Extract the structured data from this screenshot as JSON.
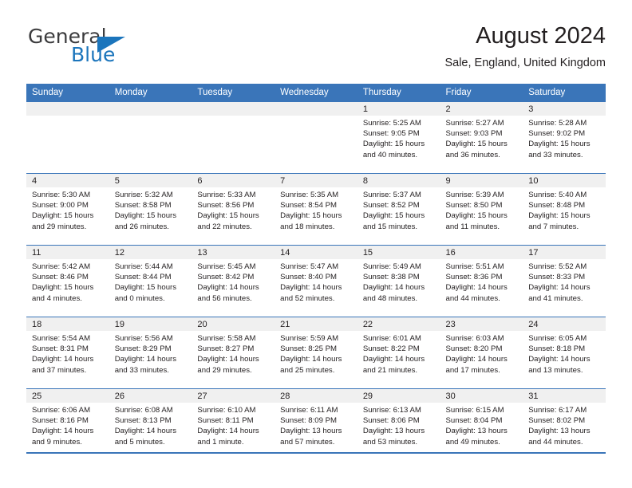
{
  "brand": {
    "name_part1": "General",
    "name_part2": "Blue",
    "triangle_icon": "triangle-icon",
    "accent_color": "#1b75bc"
  },
  "header": {
    "month_title": "August 2024",
    "location": "Sale, England, United Kingdom"
  },
  "theme": {
    "header_blue": "#3a75b9",
    "daynum_band": "#f0f0f0",
    "text": "#231f20"
  },
  "calendar": {
    "weekday_headers": [
      "Sunday",
      "Monday",
      "Tuesday",
      "Wednesday",
      "Thursday",
      "Friday",
      "Saturday"
    ],
    "weeks": [
      [
        {
          "day": "",
          "lines": []
        },
        {
          "day": "",
          "lines": []
        },
        {
          "day": "",
          "lines": []
        },
        {
          "day": "",
          "lines": []
        },
        {
          "day": "1",
          "lines": [
            "Sunrise: 5:25 AM",
            "Sunset: 9:05 PM",
            "Daylight: 15 hours",
            "and 40 minutes."
          ]
        },
        {
          "day": "2",
          "lines": [
            "Sunrise: 5:27 AM",
            "Sunset: 9:03 PM",
            "Daylight: 15 hours",
            "and 36 minutes."
          ]
        },
        {
          "day": "3",
          "lines": [
            "Sunrise: 5:28 AM",
            "Sunset: 9:02 PM",
            "Daylight: 15 hours",
            "and 33 minutes."
          ]
        }
      ],
      [
        {
          "day": "4",
          "lines": [
            "Sunrise: 5:30 AM",
            "Sunset: 9:00 PM",
            "Daylight: 15 hours",
            "and 29 minutes."
          ]
        },
        {
          "day": "5",
          "lines": [
            "Sunrise: 5:32 AM",
            "Sunset: 8:58 PM",
            "Daylight: 15 hours",
            "and 26 minutes."
          ]
        },
        {
          "day": "6",
          "lines": [
            "Sunrise: 5:33 AM",
            "Sunset: 8:56 PM",
            "Daylight: 15 hours",
            "and 22 minutes."
          ]
        },
        {
          "day": "7",
          "lines": [
            "Sunrise: 5:35 AM",
            "Sunset: 8:54 PM",
            "Daylight: 15 hours",
            "and 18 minutes."
          ]
        },
        {
          "day": "8",
          "lines": [
            "Sunrise: 5:37 AM",
            "Sunset: 8:52 PM",
            "Daylight: 15 hours",
            "and 15 minutes."
          ]
        },
        {
          "day": "9",
          "lines": [
            "Sunrise: 5:39 AM",
            "Sunset: 8:50 PM",
            "Daylight: 15 hours",
            "and 11 minutes."
          ]
        },
        {
          "day": "10",
          "lines": [
            "Sunrise: 5:40 AM",
            "Sunset: 8:48 PM",
            "Daylight: 15 hours",
            "and 7 minutes."
          ]
        }
      ],
      [
        {
          "day": "11",
          "lines": [
            "Sunrise: 5:42 AM",
            "Sunset: 8:46 PM",
            "Daylight: 15 hours",
            "and 4 minutes."
          ]
        },
        {
          "day": "12",
          "lines": [
            "Sunrise: 5:44 AM",
            "Sunset: 8:44 PM",
            "Daylight: 15 hours",
            "and 0 minutes."
          ]
        },
        {
          "day": "13",
          "lines": [
            "Sunrise: 5:45 AM",
            "Sunset: 8:42 PM",
            "Daylight: 14 hours",
            "and 56 minutes."
          ]
        },
        {
          "day": "14",
          "lines": [
            "Sunrise: 5:47 AM",
            "Sunset: 8:40 PM",
            "Daylight: 14 hours",
            "and 52 minutes."
          ]
        },
        {
          "day": "15",
          "lines": [
            "Sunrise: 5:49 AM",
            "Sunset: 8:38 PM",
            "Daylight: 14 hours",
            "and 48 minutes."
          ]
        },
        {
          "day": "16",
          "lines": [
            "Sunrise: 5:51 AM",
            "Sunset: 8:36 PM",
            "Daylight: 14 hours",
            "and 44 minutes."
          ]
        },
        {
          "day": "17",
          "lines": [
            "Sunrise: 5:52 AM",
            "Sunset: 8:33 PM",
            "Daylight: 14 hours",
            "and 41 minutes."
          ]
        }
      ],
      [
        {
          "day": "18",
          "lines": [
            "Sunrise: 5:54 AM",
            "Sunset: 8:31 PM",
            "Daylight: 14 hours",
            "and 37 minutes."
          ]
        },
        {
          "day": "19",
          "lines": [
            "Sunrise: 5:56 AM",
            "Sunset: 8:29 PM",
            "Daylight: 14 hours",
            "and 33 minutes."
          ]
        },
        {
          "day": "20",
          "lines": [
            "Sunrise: 5:58 AM",
            "Sunset: 8:27 PM",
            "Daylight: 14 hours",
            "and 29 minutes."
          ]
        },
        {
          "day": "21",
          "lines": [
            "Sunrise: 5:59 AM",
            "Sunset: 8:25 PM",
            "Daylight: 14 hours",
            "and 25 minutes."
          ]
        },
        {
          "day": "22",
          "lines": [
            "Sunrise: 6:01 AM",
            "Sunset: 8:22 PM",
            "Daylight: 14 hours",
            "and 21 minutes."
          ]
        },
        {
          "day": "23",
          "lines": [
            "Sunrise: 6:03 AM",
            "Sunset: 8:20 PM",
            "Daylight: 14 hours",
            "and 17 minutes."
          ]
        },
        {
          "day": "24",
          "lines": [
            "Sunrise: 6:05 AM",
            "Sunset: 8:18 PM",
            "Daylight: 14 hours",
            "and 13 minutes."
          ]
        }
      ],
      [
        {
          "day": "25",
          "lines": [
            "Sunrise: 6:06 AM",
            "Sunset: 8:16 PM",
            "Daylight: 14 hours",
            "and 9 minutes."
          ]
        },
        {
          "day": "26",
          "lines": [
            "Sunrise: 6:08 AM",
            "Sunset: 8:13 PM",
            "Daylight: 14 hours",
            "and 5 minutes."
          ]
        },
        {
          "day": "27",
          "lines": [
            "Sunrise: 6:10 AM",
            "Sunset: 8:11 PM",
            "Daylight: 14 hours",
            "and 1 minute."
          ]
        },
        {
          "day": "28",
          "lines": [
            "Sunrise: 6:11 AM",
            "Sunset: 8:09 PM",
            "Daylight: 13 hours",
            "and 57 minutes."
          ]
        },
        {
          "day": "29",
          "lines": [
            "Sunrise: 6:13 AM",
            "Sunset: 8:06 PM",
            "Daylight: 13 hours",
            "and 53 minutes."
          ]
        },
        {
          "day": "30",
          "lines": [
            "Sunrise: 6:15 AM",
            "Sunset: 8:04 PM",
            "Daylight: 13 hours",
            "and 49 minutes."
          ]
        },
        {
          "day": "31",
          "lines": [
            "Sunrise: 6:17 AM",
            "Sunset: 8:02 PM",
            "Daylight: 13 hours",
            "and 44 minutes."
          ]
        }
      ]
    ]
  }
}
